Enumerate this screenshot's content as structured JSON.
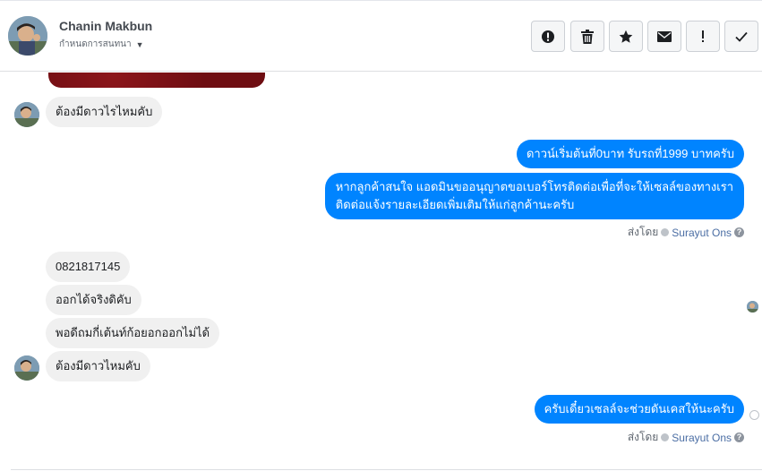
{
  "header": {
    "contact_name": "Chanin Makbun",
    "status_label": "กำหนดการสนทนา",
    "actions": [
      {
        "icon": "alert-circle-icon",
        "label": "spam"
      },
      {
        "icon": "trash-icon",
        "label": "delete"
      },
      {
        "icon": "star-icon",
        "label": "star"
      },
      {
        "icon": "envelope-icon",
        "label": "unread"
      },
      {
        "icon": "exclamation-icon",
        "label": "important"
      },
      {
        "icon": "check-icon",
        "label": "done"
      }
    ]
  },
  "messages": {
    "incoming_1": "ต้องมีดาวไรไหมคับ",
    "outgoing_1": "ดาวน์เริ่มต้นที่0บาท รับรถที่1999 บาทครับ",
    "outgoing_2_line1": "หากลูกค้าสนใจ แอดมินขออนุญาตขอเบอร์โทรติดต่อเพื่อที่จะให้เซลล์ของทางเรา",
    "outgoing_2_line2": "ติดต่อแจ้งรายละเอียดเพิ่มเติมให้แก่ลูกค้านะครับ",
    "sent_by_prefix": "ส่งโดย",
    "sent_by_name": "Surayut Ons",
    "incoming_2": "0821817145",
    "incoming_3": "ออกได้จริงดิคับ",
    "incoming_4": "พอดีถมกี่เต้นท์ก้อยอกออกไม่ได้",
    "incoming_5": "ต้องมีดาวไหมคับ",
    "outgoing_3": "ครับเดี๋ยวเซลล์จะช่วยดันเคสให้นะครับ",
    "help_glyph": "?"
  },
  "colors": {
    "outgoing_bubble": "#0084ff",
    "incoming_bubble": "#f0f0f0",
    "sender_link": "#4b6ea4"
  }
}
